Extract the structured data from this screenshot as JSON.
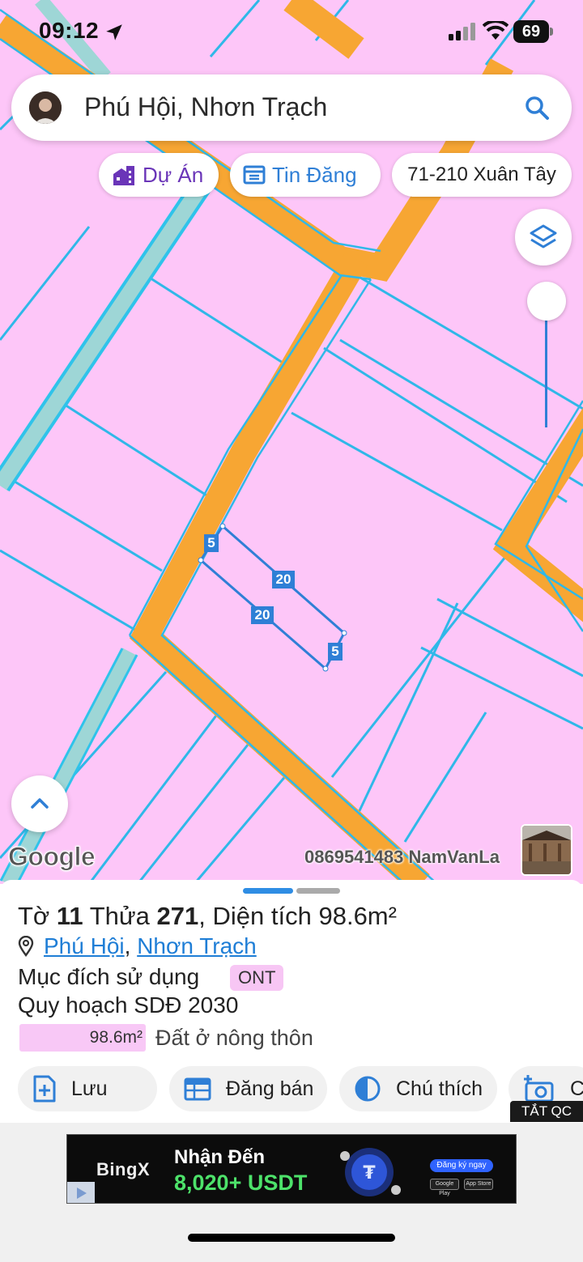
{
  "status_bar": {
    "time": "09:12",
    "battery": "69"
  },
  "search": {
    "text": "Phú Hội, Nhơn Trạch"
  },
  "chips": [
    {
      "label": "Dự Án",
      "icon": "building-icon",
      "color": "#6a35b8"
    },
    {
      "label": "Tin Đăng",
      "icon": "listing-icon",
      "color": "#2f7fd6"
    },
    {
      "label": "71-210 Xuân Tây"
    }
  ],
  "map": {
    "parcel_edges": [
      "5",
      "20",
      "20",
      "5"
    ],
    "google_label": "Google",
    "watermark": "0869541483 NamVanLa",
    "colors": {
      "land": "#fdc6f8",
      "road": "#f7a633",
      "boundary": "#2fb8e8",
      "parcel": "#2f7fd6"
    }
  },
  "info": {
    "to_label": "Tờ",
    "to_value": "11",
    "thua_label": "Thửa",
    "thua_value": "271",
    "area_label": "Diện tích",
    "area_value": "98.6m²",
    "ward": "Phú Hội",
    "district": "Nhơn Trạch",
    "purpose_label": "Mục đích sử dụng",
    "purpose_code": "ONT",
    "plan_label": "Quy hoạch SDĐ 2030",
    "plan_area": "98.6m²",
    "plan_desc": "Đất ở nông thôn"
  },
  "actions": [
    {
      "label": "Lưu",
      "icon": "add-document-icon"
    },
    {
      "label": "Đăng bán",
      "icon": "calendar-icon"
    },
    {
      "label": "Chú thích",
      "icon": "contrast-icon"
    },
    {
      "label": "Ch",
      "icon": "camera-add-icon"
    }
  ],
  "ad": {
    "close_label": "TẮT QC",
    "brand": "BingX",
    "line1": "Nhận Đến",
    "line2": "8,020+ USDT",
    "cta": "Đăng ký ngay",
    "store1": "Google Play",
    "store2": "App Store"
  }
}
